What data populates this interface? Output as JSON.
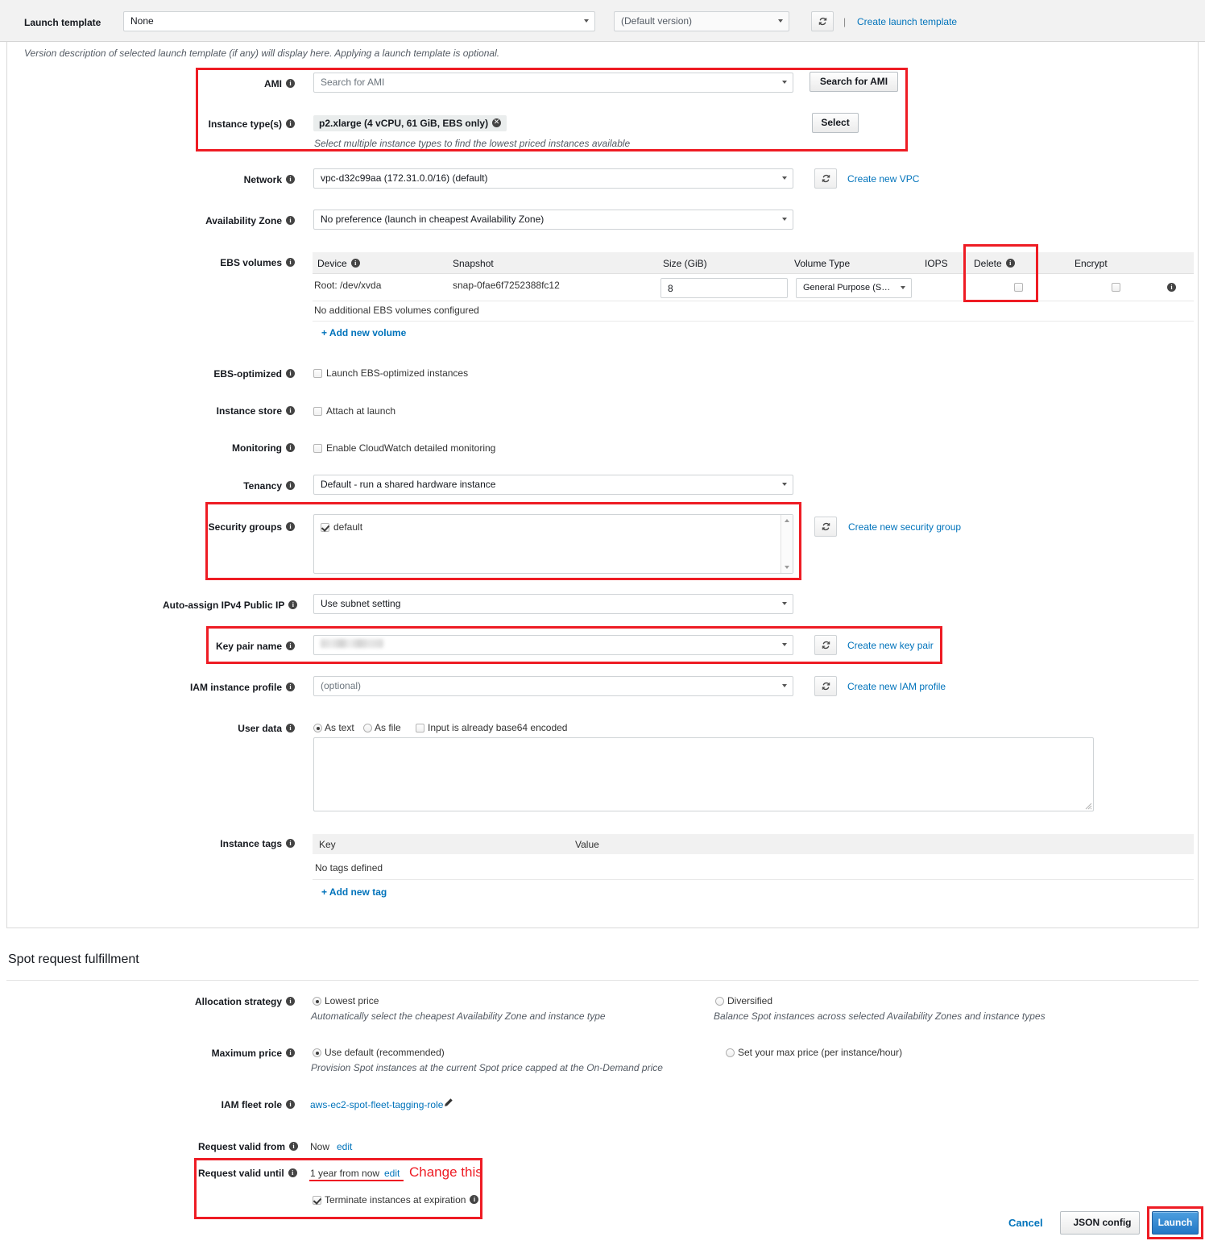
{
  "launch_template": {
    "label": "Launch template",
    "value": "None",
    "version": "(Default version)",
    "separator": "|",
    "create_link": "Create launch template",
    "description": "Version description of selected launch template (if any) will display here. Applying a launch template is optional."
  },
  "ami": {
    "label": "AMI",
    "placeholder": "Search for AMI",
    "button": "Search for AMI"
  },
  "instance_types": {
    "label": "Instance type(s)",
    "chip": "p2.xlarge (4 vCPU, 61 GiB, EBS only)",
    "chip_remove": "✖",
    "button": "Select",
    "hint": "Select multiple instance types to find the lowest priced instances available"
  },
  "network": {
    "label": "Network",
    "value": "vpc-d32c99aa (172.31.0.0/16) (default)",
    "create_link": "Create new VPC"
  },
  "availability_zone": {
    "label": "Availability Zone",
    "value": "No preference (launch in cheapest Availability Zone)"
  },
  "ebs_volumes": {
    "label": "EBS volumes",
    "columns": [
      "Device",
      "Snapshot",
      "Size (GiB)",
      "Volume Type",
      "IOPS",
      "Delete",
      "Encrypt"
    ],
    "rows": [
      {
        "device": "Root: /dev/xvda",
        "snapshot": "snap-0fae6f7252388fc12",
        "size": "8",
        "volume_type": "General Purpose (SSD)",
        "iops": "",
        "delete_checked": false,
        "encrypt_checked": false
      }
    ],
    "empty_text": "No additional EBS volumes configured",
    "add_link": "+ Add new volume"
  },
  "ebs_optimized": {
    "label": "EBS-optimized",
    "checkbox_label": "Launch EBS-optimized instances",
    "checked": false
  },
  "instance_store": {
    "label": "Instance store",
    "checkbox_label": "Attach at launch",
    "checked": false
  },
  "monitoring": {
    "label": "Monitoring",
    "checkbox_label": "Enable CloudWatch detailed monitoring",
    "checked": false
  },
  "tenancy": {
    "label": "Tenancy",
    "value": "Default - run a shared hardware instance"
  },
  "security_groups": {
    "label": "Security groups",
    "items": [
      {
        "name": "default",
        "checked": true
      }
    ],
    "create_link": "Create new security group"
  },
  "auto_assign_ip": {
    "label": "Auto-assign IPv4 Public IP",
    "value": "Use subnet setting"
  },
  "key_pair": {
    "label": "Key pair name",
    "value": "",
    "create_link": "Create new key pair"
  },
  "iam_profile": {
    "label": "IAM instance profile",
    "value": "(optional)",
    "create_link": "Create new IAM profile"
  },
  "user_data": {
    "label": "User data",
    "as_text_label": "As text",
    "as_file_label": "As file",
    "base64_label": "Input is already base64 encoded",
    "mode": "As text",
    "base64_checked": false,
    "value": ""
  },
  "instance_tags": {
    "label": "Instance tags",
    "columns": [
      "Key",
      "Value"
    ],
    "empty_text": "No tags defined",
    "add_link": "+ Add new tag"
  },
  "spot_fulfillment": {
    "title": "Spot request fulfillment",
    "allocation_strategy": {
      "label": "Allocation strategy",
      "selected": "Lowest price",
      "options": [
        {
          "label": "Lowest price",
          "desc": "Automatically select the cheapest Availability Zone and instance type",
          "selected": true
        },
        {
          "label": "Diversified",
          "desc": "Balance Spot instances across selected Availability Zones and instance types",
          "selected": false
        }
      ]
    },
    "maximum_price": {
      "label": "Maximum price",
      "selected": "Use default (recommended)",
      "options": [
        {
          "label": "Use default (recommended)",
          "desc": "Provision Spot instances at the current Spot price capped at the On-Demand price",
          "selected": true
        },
        {
          "label": "Set your max price (per instance/hour)",
          "desc": "",
          "selected": false
        }
      ]
    },
    "iam_fleet_role": {
      "label": "IAM fleet role",
      "value": "aws-ec2-spot-fleet-tagging-role"
    },
    "valid_from": {
      "label": "Request valid from",
      "value": "Now",
      "edit": "edit"
    },
    "valid_until": {
      "label": "Request valid until",
      "value": "1 year from now",
      "edit": "edit",
      "terminate_label": "Terminate instances at expiration",
      "terminate_checked": true
    }
  },
  "annotations": {
    "change_this": "Change this",
    "highlight_color": "#ee1c24"
  },
  "footer": {
    "cancel": "Cancel",
    "json_config": "JSON config",
    "launch": "Launch"
  }
}
